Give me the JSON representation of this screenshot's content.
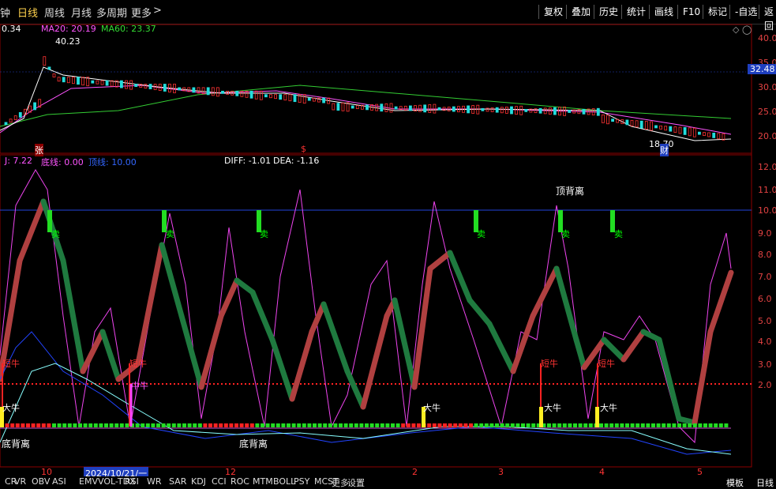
{
  "toolbar": {
    "left_tabs": [
      "钟",
      "日线",
      "周线",
      "月线",
      "多周期",
      "更多"
    ],
    "right_tabs": [
      "复权",
      "叠加",
      "历史",
      "统计",
      "画线",
      "F10",
      "标记",
      "-自选",
      "返回"
    ]
  },
  "price_panel": {
    "ma_labels": [
      {
        "text": "0.34",
        "color": "#ffffff"
      },
      {
        "text": "MA20: 20.19",
        "color": "#ff55ff"
      },
      {
        "text": "MA60: 23.37",
        "color": "#33dd33"
      }
    ],
    "high_label": "40.23",
    "low_label": "18.70",
    "current_price": "32.48",
    "axis_labels": [
      "40.0",
      "35.0",
      "30.0",
      "25.0",
      "20.0"
    ],
    "marker_zhang": "张",
    "marker_s": "$",
    "marker_cai": "财"
  },
  "indicator_panel": {
    "labels": [
      {
        "text": "J: 7.22",
        "color": "#ff55ff"
      },
      {
        "text": "底线: 0.00",
        "color": "#ff55ff"
      },
      {
        "text": "顶线: 10.00",
        "color": "#3366ff"
      }
    ],
    "macd_labels": [
      {
        "text": "DIFF: -1.01",
        "color": "#ffffff"
      },
      {
        "text": "DEA: -1.16",
        "color": "#ffffff"
      }
    ],
    "axis_labels": [
      "12.0",
      "11.0",
      "10.0",
      "9.0",
      "8.0",
      "7.0",
      "6.0",
      "5.0",
      "4.0",
      "3.0",
      "2.0"
    ],
    "annotation_top_divergence": "顶背离",
    "annotation_bottom_divergence": "底背离",
    "sell_label": "卖",
    "short_bull_label": "短牛",
    "big_bull_label": "大牛",
    "mid_bull_label": "中牛"
  },
  "time_axis": {
    "labels": [
      "10",
      "2024/10/21/一",
      "12",
      "2",
      "3",
      "4",
      "5"
    ]
  },
  "bottom_tabs": [
    "CR",
    "VR",
    "OBV",
    "ASI",
    "EMV",
    "VOL-TDX",
    "RSI",
    "WR",
    "SAR",
    "KDJ",
    "CCI",
    "ROC",
    "MTM",
    "BOLL",
    "PSY",
    "MCST",
    "更多",
    "设置"
  ],
  "bottom_right": [
    "模板",
    "日线"
  ]
}
